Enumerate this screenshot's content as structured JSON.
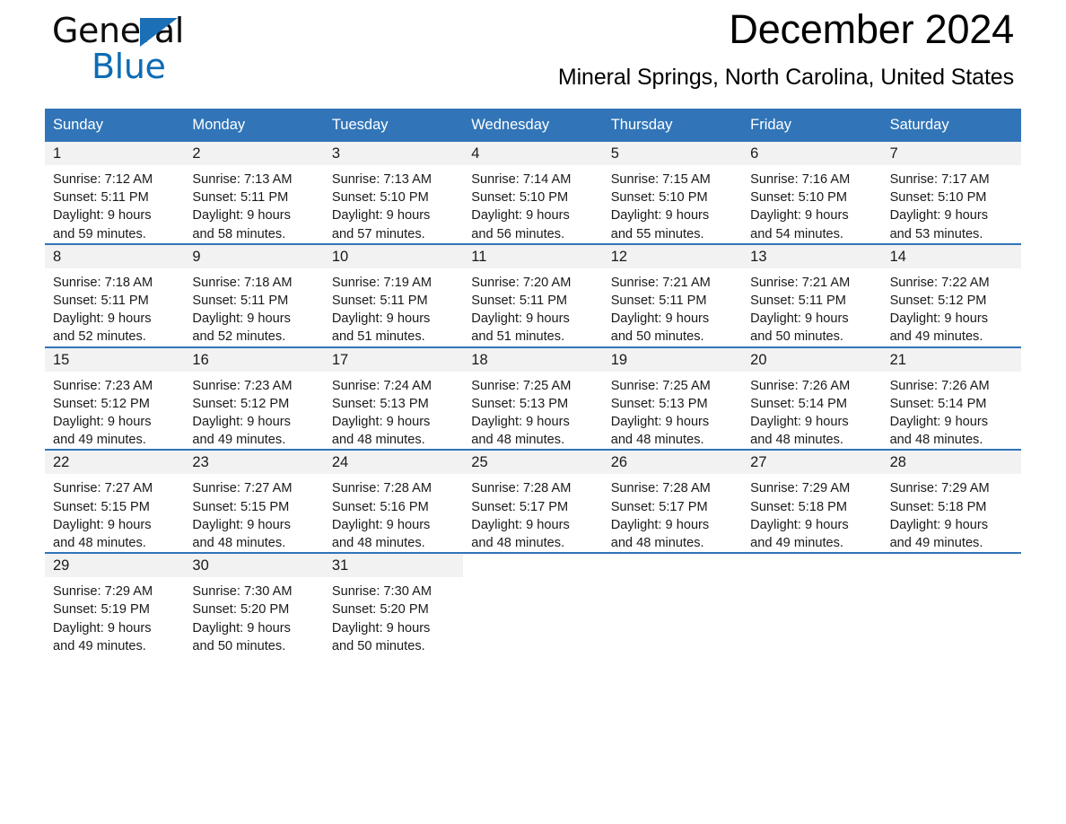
{
  "brand": {
    "name_part1": "General",
    "name_part2": "Blue"
  },
  "header": {
    "month_title": "December 2024",
    "location": "Mineral Springs, North Carolina, United States"
  },
  "calendar": {
    "weekday_headers": [
      "Sunday",
      "Monday",
      "Tuesday",
      "Wednesday",
      "Thursday",
      "Friday",
      "Saturday"
    ],
    "accent_color": "#3175b8",
    "daynum_band_color": "#f2f2f2",
    "weeks": [
      [
        {
          "day": "1",
          "sunrise": "Sunrise: 7:12 AM",
          "sunset": "Sunset: 5:11 PM",
          "daylight_1": "Daylight: 9 hours",
          "daylight_2": "and 59 minutes."
        },
        {
          "day": "2",
          "sunrise": "Sunrise: 7:13 AM",
          "sunset": "Sunset: 5:11 PM",
          "daylight_1": "Daylight: 9 hours",
          "daylight_2": "and 58 minutes."
        },
        {
          "day": "3",
          "sunrise": "Sunrise: 7:13 AM",
          "sunset": "Sunset: 5:10 PM",
          "daylight_1": "Daylight: 9 hours",
          "daylight_2": "and 57 minutes."
        },
        {
          "day": "4",
          "sunrise": "Sunrise: 7:14 AM",
          "sunset": "Sunset: 5:10 PM",
          "daylight_1": "Daylight: 9 hours",
          "daylight_2": "and 56 minutes."
        },
        {
          "day": "5",
          "sunrise": "Sunrise: 7:15 AM",
          "sunset": "Sunset: 5:10 PM",
          "daylight_1": "Daylight: 9 hours",
          "daylight_2": "and 55 minutes."
        },
        {
          "day": "6",
          "sunrise": "Sunrise: 7:16 AM",
          "sunset": "Sunset: 5:10 PM",
          "daylight_1": "Daylight: 9 hours",
          "daylight_2": "and 54 minutes."
        },
        {
          "day": "7",
          "sunrise": "Sunrise: 7:17 AM",
          "sunset": "Sunset: 5:10 PM",
          "daylight_1": "Daylight: 9 hours",
          "daylight_2": "and 53 minutes."
        }
      ],
      [
        {
          "day": "8",
          "sunrise": "Sunrise: 7:18 AM",
          "sunset": "Sunset: 5:11 PM",
          "daylight_1": "Daylight: 9 hours",
          "daylight_2": "and 52 minutes."
        },
        {
          "day": "9",
          "sunrise": "Sunrise: 7:18 AM",
          "sunset": "Sunset: 5:11 PM",
          "daylight_1": "Daylight: 9 hours",
          "daylight_2": "and 52 minutes."
        },
        {
          "day": "10",
          "sunrise": "Sunrise: 7:19 AM",
          "sunset": "Sunset: 5:11 PM",
          "daylight_1": "Daylight: 9 hours",
          "daylight_2": "and 51 minutes."
        },
        {
          "day": "11",
          "sunrise": "Sunrise: 7:20 AM",
          "sunset": "Sunset: 5:11 PM",
          "daylight_1": "Daylight: 9 hours",
          "daylight_2": "and 51 minutes."
        },
        {
          "day": "12",
          "sunrise": "Sunrise: 7:21 AM",
          "sunset": "Sunset: 5:11 PM",
          "daylight_1": "Daylight: 9 hours",
          "daylight_2": "and 50 minutes."
        },
        {
          "day": "13",
          "sunrise": "Sunrise: 7:21 AM",
          "sunset": "Sunset: 5:11 PM",
          "daylight_1": "Daylight: 9 hours",
          "daylight_2": "and 50 minutes."
        },
        {
          "day": "14",
          "sunrise": "Sunrise: 7:22 AM",
          "sunset": "Sunset: 5:12 PM",
          "daylight_1": "Daylight: 9 hours",
          "daylight_2": "and 49 minutes."
        }
      ],
      [
        {
          "day": "15",
          "sunrise": "Sunrise: 7:23 AM",
          "sunset": "Sunset: 5:12 PM",
          "daylight_1": "Daylight: 9 hours",
          "daylight_2": "and 49 minutes."
        },
        {
          "day": "16",
          "sunrise": "Sunrise: 7:23 AM",
          "sunset": "Sunset: 5:12 PM",
          "daylight_1": "Daylight: 9 hours",
          "daylight_2": "and 49 minutes."
        },
        {
          "day": "17",
          "sunrise": "Sunrise: 7:24 AM",
          "sunset": "Sunset: 5:13 PM",
          "daylight_1": "Daylight: 9 hours",
          "daylight_2": "and 48 minutes."
        },
        {
          "day": "18",
          "sunrise": "Sunrise: 7:25 AM",
          "sunset": "Sunset: 5:13 PM",
          "daylight_1": "Daylight: 9 hours",
          "daylight_2": "and 48 minutes."
        },
        {
          "day": "19",
          "sunrise": "Sunrise: 7:25 AM",
          "sunset": "Sunset: 5:13 PM",
          "daylight_1": "Daylight: 9 hours",
          "daylight_2": "and 48 minutes."
        },
        {
          "day": "20",
          "sunrise": "Sunrise: 7:26 AM",
          "sunset": "Sunset: 5:14 PM",
          "daylight_1": "Daylight: 9 hours",
          "daylight_2": "and 48 minutes."
        },
        {
          "day": "21",
          "sunrise": "Sunrise: 7:26 AM",
          "sunset": "Sunset: 5:14 PM",
          "daylight_1": "Daylight: 9 hours",
          "daylight_2": "and 48 minutes."
        }
      ],
      [
        {
          "day": "22",
          "sunrise": "Sunrise: 7:27 AM",
          "sunset": "Sunset: 5:15 PM",
          "daylight_1": "Daylight: 9 hours",
          "daylight_2": "and 48 minutes."
        },
        {
          "day": "23",
          "sunrise": "Sunrise: 7:27 AM",
          "sunset": "Sunset: 5:15 PM",
          "daylight_1": "Daylight: 9 hours",
          "daylight_2": "and 48 minutes."
        },
        {
          "day": "24",
          "sunrise": "Sunrise: 7:28 AM",
          "sunset": "Sunset: 5:16 PM",
          "daylight_1": "Daylight: 9 hours",
          "daylight_2": "and 48 minutes."
        },
        {
          "day": "25",
          "sunrise": "Sunrise: 7:28 AM",
          "sunset": "Sunset: 5:17 PM",
          "daylight_1": "Daylight: 9 hours",
          "daylight_2": "and 48 minutes."
        },
        {
          "day": "26",
          "sunrise": "Sunrise: 7:28 AM",
          "sunset": "Sunset: 5:17 PM",
          "daylight_1": "Daylight: 9 hours",
          "daylight_2": "and 48 minutes."
        },
        {
          "day": "27",
          "sunrise": "Sunrise: 7:29 AM",
          "sunset": "Sunset: 5:18 PM",
          "daylight_1": "Daylight: 9 hours",
          "daylight_2": "and 49 minutes."
        },
        {
          "day": "28",
          "sunrise": "Sunrise: 7:29 AM",
          "sunset": "Sunset: 5:18 PM",
          "daylight_1": "Daylight: 9 hours",
          "daylight_2": "and 49 minutes."
        }
      ],
      [
        {
          "day": "29",
          "sunrise": "Sunrise: 7:29 AM",
          "sunset": "Sunset: 5:19 PM",
          "daylight_1": "Daylight: 9 hours",
          "daylight_2": "and 49 minutes."
        },
        {
          "day": "30",
          "sunrise": "Sunrise: 7:30 AM",
          "sunset": "Sunset: 5:20 PM",
          "daylight_1": "Daylight: 9 hours",
          "daylight_2": "and 50 minutes."
        },
        {
          "day": "31",
          "sunrise": "Sunrise: 7:30 AM",
          "sunset": "Sunset: 5:20 PM",
          "daylight_1": "Daylight: 9 hours",
          "daylight_2": "and 50 minutes."
        },
        {
          "day": "",
          "sunrise": "",
          "sunset": "",
          "daylight_1": "",
          "daylight_2": ""
        },
        {
          "day": "",
          "sunrise": "",
          "sunset": "",
          "daylight_1": "",
          "daylight_2": ""
        },
        {
          "day": "",
          "sunrise": "",
          "sunset": "",
          "daylight_1": "",
          "daylight_2": ""
        },
        {
          "day": "",
          "sunrise": "",
          "sunset": "",
          "daylight_1": "",
          "daylight_2": ""
        }
      ]
    ]
  }
}
